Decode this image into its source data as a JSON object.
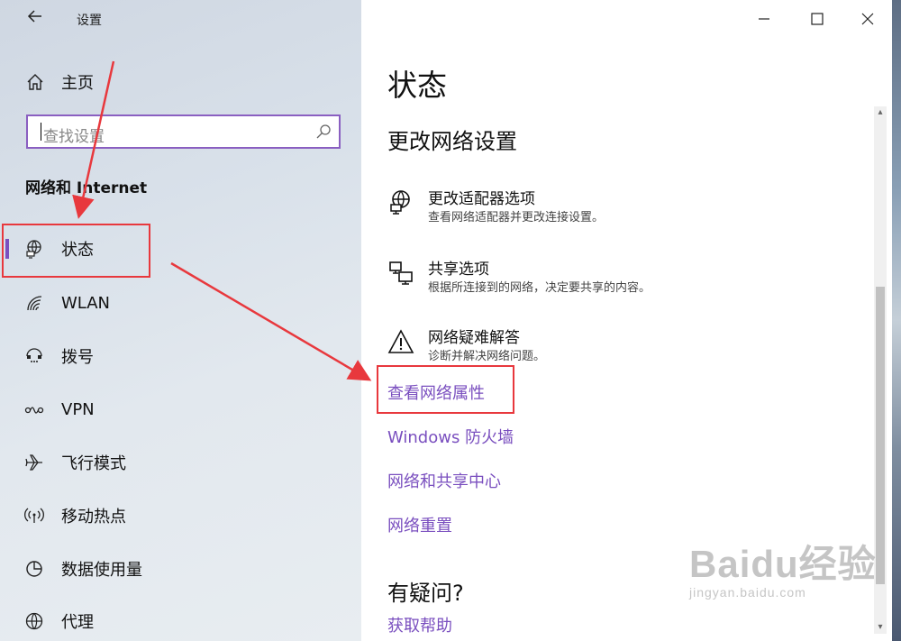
{
  "window": {
    "title": "设置",
    "back_icon": "back-arrow-icon",
    "controls": [
      "minimize-icon",
      "maximize-icon",
      "close-icon"
    ]
  },
  "sidebar": {
    "home_label": "主页",
    "search_placeholder": "查找设置",
    "section_title": "网络和 Internet",
    "items": [
      {
        "label": "状态",
        "icon": "globe-monitor-icon",
        "selected": true
      },
      {
        "label": "WLAN",
        "icon": "wifi-icon",
        "selected": false
      },
      {
        "label": "拨号",
        "icon": "dialup-icon",
        "selected": false
      },
      {
        "label": "VPN",
        "icon": "vpn-icon",
        "selected": false
      },
      {
        "label": "飞行模式",
        "icon": "airplane-icon",
        "selected": false
      },
      {
        "label": "移动热点",
        "icon": "hotspot-icon",
        "selected": false
      },
      {
        "label": "数据使用量",
        "icon": "data-usage-icon",
        "selected": false
      },
      {
        "label": "代理",
        "icon": "globe-icon",
        "selected": false
      }
    ]
  },
  "main": {
    "title": "状态",
    "change_section": "更改网络设置",
    "options": [
      {
        "title": "更改适配器选项",
        "desc": "查看网络适配器并更改连接设置。",
        "icon": "adapter-icon"
      },
      {
        "title": "共享选项",
        "desc": "根据所连接到的网络，决定要共享的内容。",
        "icon": "sharing-icon"
      },
      {
        "title": "网络疑难解答",
        "desc": "诊断并解决网络问题。",
        "icon": "warning-icon"
      }
    ],
    "links": [
      "查看网络属性",
      "Windows 防火墙",
      "网络和共享中心",
      "网络重置"
    ],
    "help_title": "有疑问?",
    "help_link": "获取帮助"
  },
  "watermark": {
    "brand": "Baidu经验",
    "url": "jingyan.baidu.com"
  },
  "colors": {
    "accent": "#7a4fbf",
    "annotation_red": "#e8383d"
  }
}
